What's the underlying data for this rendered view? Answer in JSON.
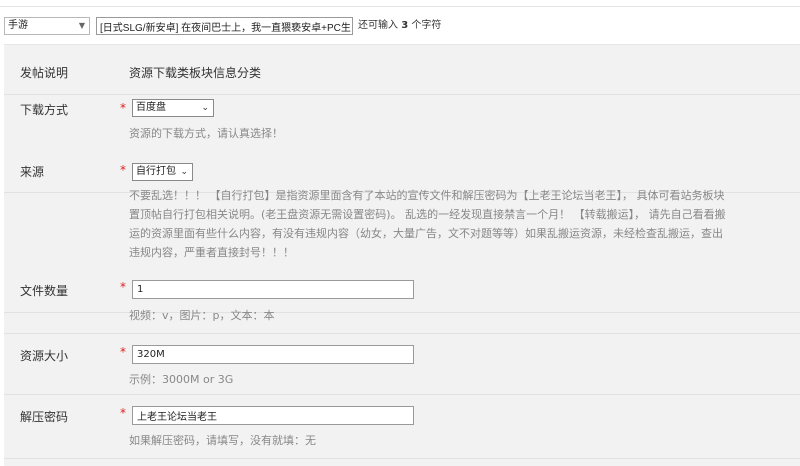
{
  "topbar": {
    "category_value": "手游",
    "title_value": "[日式SLG/新安卓] 在夜间巴士上，我一直猥亵安卓+PC生",
    "remain_prefix": "还可输入",
    "remain_count": "3",
    "remain_suffix": "个字符"
  },
  "form": {
    "intro": {
      "label": "发帖说明",
      "text": "资源下载类板块信息分类"
    },
    "download": {
      "label": "下载方式",
      "value": "百度盘",
      "hint": "资源的下载方式，请认真选择！"
    },
    "source": {
      "label": "来源",
      "value": "自行打包",
      "desc": [
        "不要乱选！！！ 【自行打包】是指资源里面含有了本站的宣传文件和解压密码为【上老王论坛当老王】， 具体可看站务板块",
        "置顶帖自行打包相关说明。(老王盘资源无需设置密码)。 乱选的一经发现直接禁言一个月！ 【转载搬运】， 请先自己看看搬",
        "运的资源里面有些什么内容，有没有违规内容（幼女，大量广告，文不对题等等）如果乱搬运资源，未经检查乱搬运，查出",
        "违规内容，严重者直接封号！！！"
      ]
    },
    "file_count": {
      "label": "文件数量",
      "value": "1",
      "hint": "视频：v，图片：p，文本：本"
    },
    "size": {
      "label": "资源大小",
      "value": "320M",
      "hint": "示例：3000M or 3G"
    },
    "password": {
      "label": "解压密码",
      "value": "上老王论坛当老王",
      "hint": "如果解压密码，请填写，没有就填：无"
    },
    "required_mark": "*"
  }
}
